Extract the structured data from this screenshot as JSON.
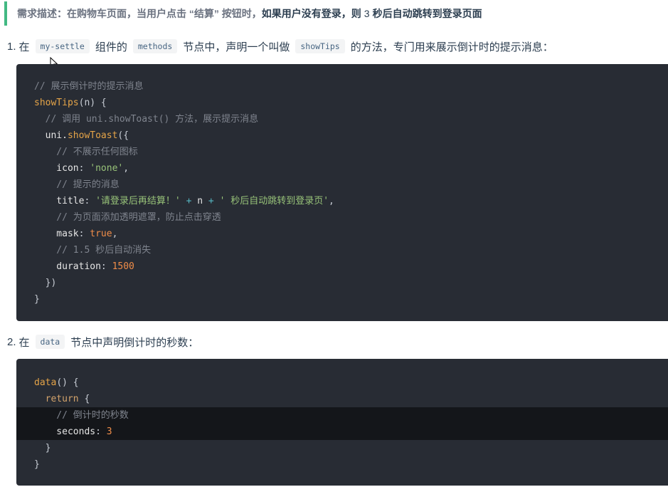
{
  "requirement": {
    "prefix": "需求描述：在购物车页面，当用户点击 “结算” 按钮时，",
    "strong": "如果用户没有登录，则",
    "number": "3",
    "suffix": "秒后自动跳转到登录页面"
  },
  "step1": {
    "num": "1.",
    "t1": "在",
    "code1": "my-settle",
    "t2": "组件的",
    "code2": "methods",
    "t3": "节点中，声明一个叫做",
    "code3": "showTips",
    "t4": "的方法，专门用来展示倒计时的提示消息："
  },
  "step2": {
    "num": "2.",
    "t1": "在",
    "code1": "data",
    "t2": "节点中声明倒计时的秒数："
  },
  "code_block_1": {
    "l1": "// 展示倒计时的提示消息",
    "l2_fn": "showTips",
    "l2_rest": "(n) {",
    "l3": "  // 调用 uni.showToast() 方法，展示提示消息",
    "l4_obj": "  uni.",
    "l4_fn": "showToast",
    "l4_rest": "({",
    "l5": "    // 不展示任何图标",
    "l6_key": "    icon",
    "l6_colon": ": ",
    "l6_val": "'none'",
    "l6_end": ",",
    "l7": "    // 提示的消息",
    "l8_key": "    title",
    "l8_colon": ": ",
    "l8_str1": "'请登录后再结算！'",
    "l8_plus1": " + ",
    "l8_n": "n",
    "l8_plus2": " + ",
    "l8_str2": "' 秒后自动跳转到登录页'",
    "l8_end": ",",
    "l9": "    // 为页面添加透明遮罩，防止点击穿透",
    "l10_key": "    mask",
    "l10_colon": ": ",
    "l10_val": "true",
    "l10_end": ",",
    "l11": "    // 1.5 秒后自动消失",
    "l12_key": "    duration",
    "l12_colon": ": ",
    "l12_val": "1500",
    "l13": "  })",
    "l14": "}"
  },
  "code_block_2": {
    "l1_fn": "data",
    "l1_rest": "() {",
    "l2_kw": "  return",
    "l2_rest": " {",
    "l3": "    // 倒计时的秒数",
    "l4_key": "    seconds",
    "l4_colon": ": ",
    "l4_val": "3",
    "l5": "  }",
    "l6": "}"
  },
  "colors": {
    "accent": "#42b983",
    "code_bg": "#282c34",
    "highlight_bg": "#14161a"
  },
  "icons": {
    "cursor": "mouse-pointer-icon"
  }
}
